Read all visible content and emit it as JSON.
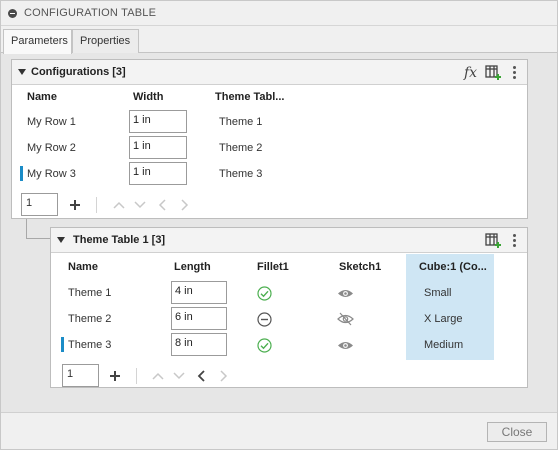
{
  "window": {
    "title": "CONFIGURATION TABLE"
  },
  "tabs": [
    {
      "label": "Parameters",
      "active": true
    },
    {
      "label": "Properties",
      "active": false
    }
  ],
  "configurations": {
    "title": "Configurations [3]",
    "columns": [
      "Name",
      "Width",
      "Theme Tabl..."
    ],
    "rows": [
      {
        "name": "My Row 1",
        "width": "1 in",
        "theme": "Theme 1",
        "marked": false
      },
      {
        "name": "My Row 2",
        "width": "1 in",
        "theme": "Theme 2",
        "marked": false
      },
      {
        "name": "My Row 3",
        "width": "1 in",
        "theme": "Theme 3",
        "marked": true
      }
    ],
    "pager_value": "1",
    "icons": [
      "fx-icon",
      "table-add-icon",
      "more-icon"
    ]
  },
  "theme_table": {
    "title": "Theme Table 1 [3]",
    "columns": [
      "Name",
      "Length",
      "Fillet1",
      "Sketch1",
      "Cube:1 (Co..."
    ],
    "rows": [
      {
        "name": "Theme 1",
        "length": "4 in",
        "fillet": "check-circle-icon",
        "sketch": "eye-icon",
        "cube": "Small",
        "marked": false
      },
      {
        "name": "Theme 2",
        "length": "6 in",
        "fillet": "minus-circle-icon",
        "sketch": "eye-off-icon",
        "cube": "X Large",
        "marked": false
      },
      {
        "name": "Theme 3",
        "length": "8 in",
        "fillet": "check-circle-icon",
        "sketch": "eye-icon",
        "cube": "Medium",
        "marked": true
      }
    ],
    "pager_value": "1",
    "icons": [
      "table-add-icon",
      "more-icon"
    ]
  },
  "footer": {
    "close_label": "Close"
  },
  "colors": {
    "accent": "#1b8cc7",
    "highlight": "#cfe6f4",
    "check": "#4caf50"
  }
}
